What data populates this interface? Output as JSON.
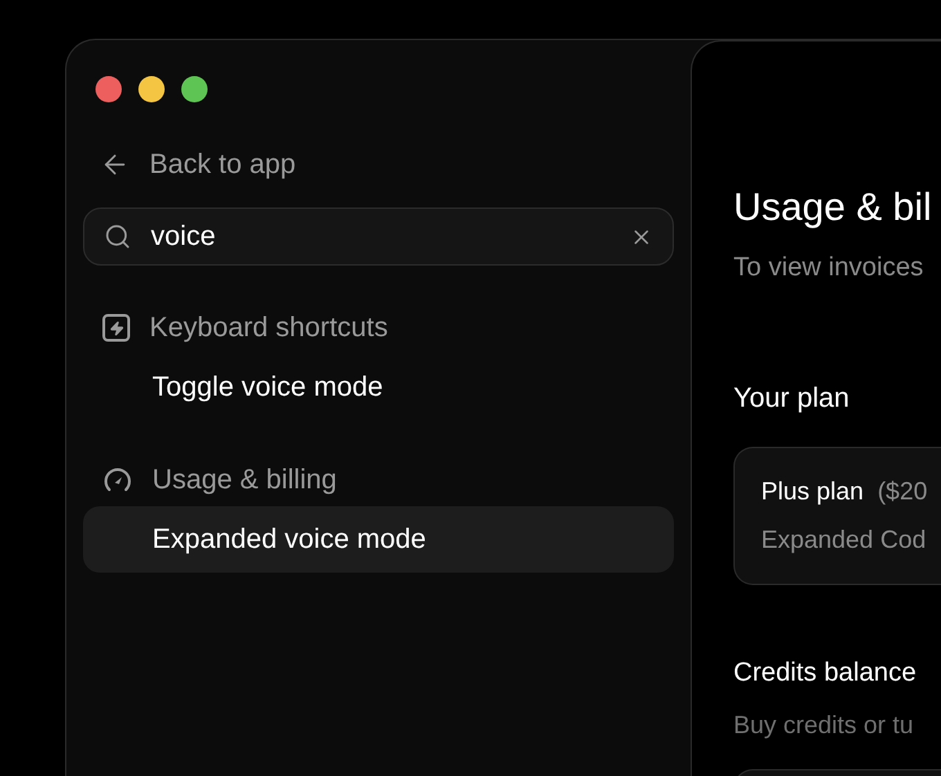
{
  "window": {
    "controls": [
      {
        "color": "#ec5f5e"
      },
      {
        "color": "#f4c542"
      },
      {
        "color": "#5ec453"
      }
    ]
  },
  "sidebar": {
    "back_link": "Back to app",
    "search": {
      "value": "voice"
    },
    "groups": [
      {
        "kind": "keyboard",
        "title": "Keyboard shortcuts",
        "items": [
          {
            "label": "Toggle voice mode",
            "selected": false
          }
        ]
      },
      {
        "kind": "gauge",
        "title": "Usage & billing",
        "items": [
          {
            "label": "Expanded voice mode",
            "selected": true
          }
        ]
      }
    ]
  },
  "main": {
    "title": "Usage & bil",
    "subtitle": "To view invoices",
    "plan": {
      "heading": "Your plan",
      "name": "Plus plan",
      "price": "($20",
      "description": "Expanded Cod"
    },
    "credits": {
      "heading": "Credits balance",
      "description": "Buy credits or tu"
    }
  }
}
